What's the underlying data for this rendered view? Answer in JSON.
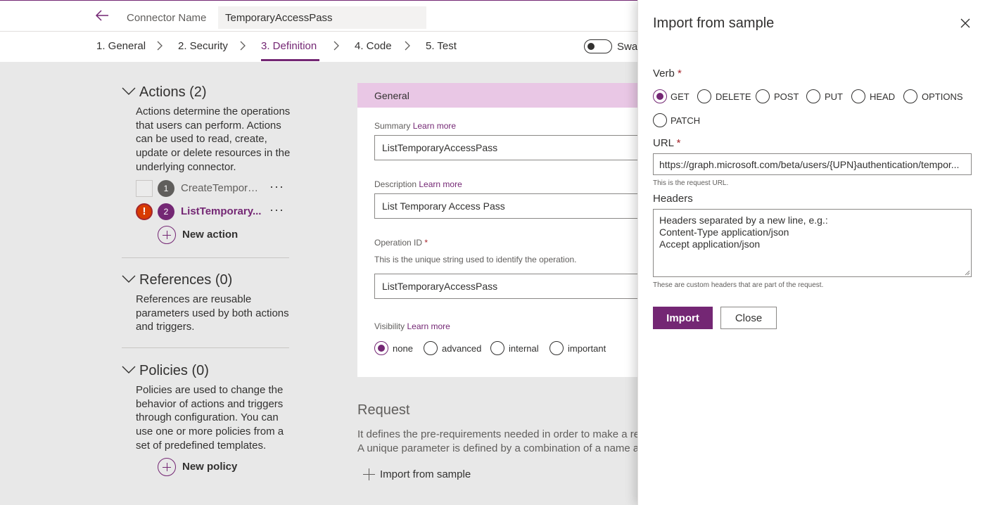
{
  "header": {
    "connector_label": "Connector Name",
    "connector_value": "TemporaryAccessPass"
  },
  "tabs": [
    {
      "label": "1. General"
    },
    {
      "label": "2. Security"
    },
    {
      "label": "3. Definition",
      "active": true
    },
    {
      "label": "4. Code"
    },
    {
      "label": "5. Test"
    }
  ],
  "swagger_toggle_label": "Swag",
  "actions": {
    "title": "Actions (2)",
    "description": "Actions determine the operations that users can perform. Actions can be used to read, create, update or delete resources in the underlying connector.",
    "items": [
      {
        "number": "1",
        "name": "CreateTempora...",
        "error": false
      },
      {
        "number": "2",
        "name": "ListTemporary...",
        "error": true,
        "error_symbol": "!"
      }
    ],
    "ellipsis": "···",
    "add_label": "New action"
  },
  "references": {
    "title": "References (0)",
    "description": "References are reusable parameters used by both actions and triggers."
  },
  "policies": {
    "title": "Policies (0)",
    "description": "Policies are used to change the behavior of actions and triggers through configuration. You can use one or more policies from a set of predefined templates.",
    "add_label": "New policy"
  },
  "general": {
    "header": "General",
    "summary_label": "Summary",
    "learn_more": "Learn more",
    "summary_value": "ListTemporaryAccessPass",
    "description_label": "Description",
    "description_value": "List Temporary Access Pass",
    "operation_id_label": "Operation ID",
    "required_mark": "*",
    "operation_id_hint": "This is the unique string used to identify the operation.",
    "operation_id_value": "ListTemporaryAccessPass",
    "visibility_label": "Visibility",
    "visibility_options": [
      "none",
      "advanced",
      "internal",
      "important"
    ],
    "visibility_selected": "none"
  },
  "request": {
    "title": "Request",
    "desc_line1": "It defines the pre-requirements needed in order to make a reque",
    "desc_line2": "A unique parameter is defined by a combination of a name and l",
    "import_label": "Import from sample"
  },
  "panel": {
    "title": "Import from sample",
    "verb_label": "Verb",
    "verbs": [
      "GET",
      "DELETE",
      "POST",
      "PUT",
      "HEAD",
      "OPTIONS",
      "PATCH"
    ],
    "verb_selected": "GET",
    "url_label": "URL",
    "url_value": "https://graph.microsoft.com/beta/users/{UPN}authentication/tempor...",
    "url_hint": "This is the request URL.",
    "headers_label": "Headers",
    "headers_placeholder": "Headers separated by a new line, e.g.:\nContent-Type application/json\nAccept application/json",
    "headers_hint": "These are custom headers that are part of the request.",
    "import_button": "Import",
    "close_button": "Close"
  },
  "colors": {
    "accent": "#742774",
    "header_band": "#e9c7e5",
    "error": "#d83b01"
  }
}
